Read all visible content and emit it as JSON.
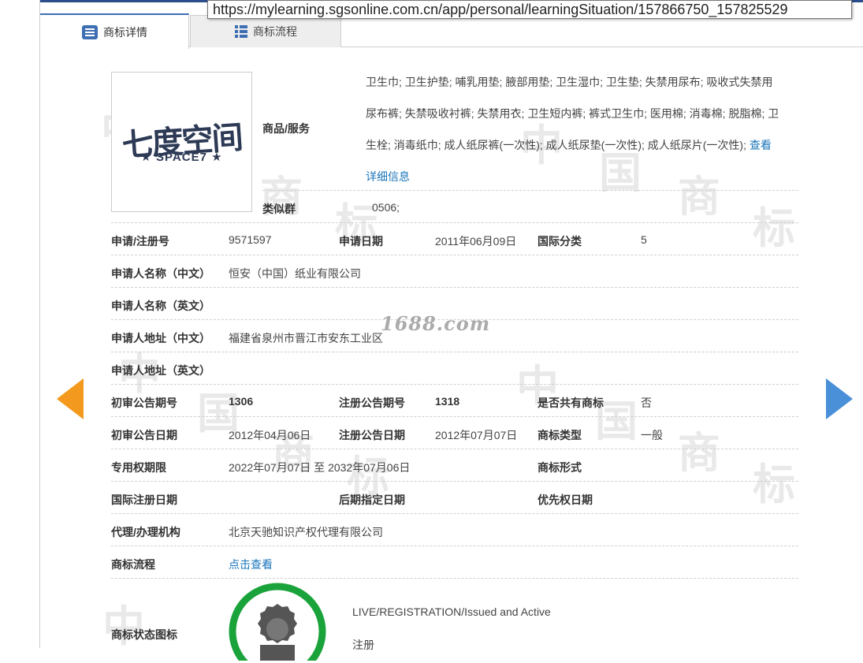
{
  "url": "https://mylearning.sgsonline.com.cn/app/personal/learningSituation/157866750_157825529",
  "tabs": [
    {
      "label": "商标详情",
      "icon": "document-list-icon",
      "active": true
    },
    {
      "label": "商标流程",
      "icon": "grid-list-icon",
      "active": false
    }
  ],
  "logo": {
    "main": "七度空间",
    "sub": "SPACE7"
  },
  "goods": {
    "label": "商品/服务",
    "line1": "卫生巾; 卫生护垫; 哺乳用垫; 腋部用垫; 卫生湿巾; 卫生垫; 失禁用尿布; 吸收式失禁用",
    "line2": "尿布裤; 失禁吸收衬裤; 失禁用衣; 卫生短内裤; 裤式卫生巾; 医用棉; 消毒棉; 脱脂棉; 卫",
    "line3": "生栓; 消毒纸巾; 成人纸尿裤(一次性); 成人纸尿垫(一次性); 成人纸尿片(一次性);",
    "more_a": "查看",
    "more_b": "详细信息"
  },
  "similar": {
    "label": "类似群",
    "value": "0506;"
  },
  "rows": {
    "appno_label": "申请/注册号",
    "appno": "9571597",
    "appdate_label": "申请日期",
    "appdate": "2011年06月09日",
    "intl_label": "国际分类",
    "intl": "5",
    "applicant_cn_label": "申请人名称（中文）",
    "applicant_cn": "恒安（中国）纸业有限公司",
    "applicant_en_label": "申请人名称（英文）",
    "applicant_en": "",
    "addr_cn_label": "申请人地址（中文）",
    "addr_cn": "福建省泉州市晋江市安东工业区",
    "addr_en_label": "申请人地址（英文）",
    "addr_en": "",
    "prelim_no_label": "初审公告期号",
    "prelim_no": "1306",
    "reg_no_label": "注册公告期号",
    "reg_no": "1318",
    "shared_label": "是否共有商标",
    "shared": "否",
    "prelim_date_label": "初审公告日期",
    "prelim_date": "2012年04月06日",
    "reg_date_label": "注册公告日期",
    "reg_date": "2012年07月07日",
    "type_label": "商标类型",
    "type": "一般",
    "term_label": "专用权期限",
    "term": "2022年07月07日 至 2032年07月06日",
    "form_label": "商标形式",
    "form": "",
    "intl_reg_label": "国际注册日期",
    "intl_reg": "",
    "later_label": "后期指定日期",
    "later": "",
    "priority_label": "优先权日期",
    "priority": "",
    "agent_label": "代理/办理机构",
    "agent": "北京天驰知识产权代理有限公司",
    "flow_label": "商标流程",
    "flow": "点击查看"
  },
  "status": {
    "label": "商标状态图标",
    "en": "LIVE/REGISTRATION/Issued and Active",
    "cn": "注册"
  },
  "watermark": {
    "site": "1688.com",
    "chars": [
      "中",
      "国",
      "商",
      "标"
    ]
  },
  "colors": {
    "accent": "#1a75bb",
    "arrow_left": "#f39a1e",
    "arrow_right": "#4a90d9",
    "status_ring": "#1aa33a"
  }
}
